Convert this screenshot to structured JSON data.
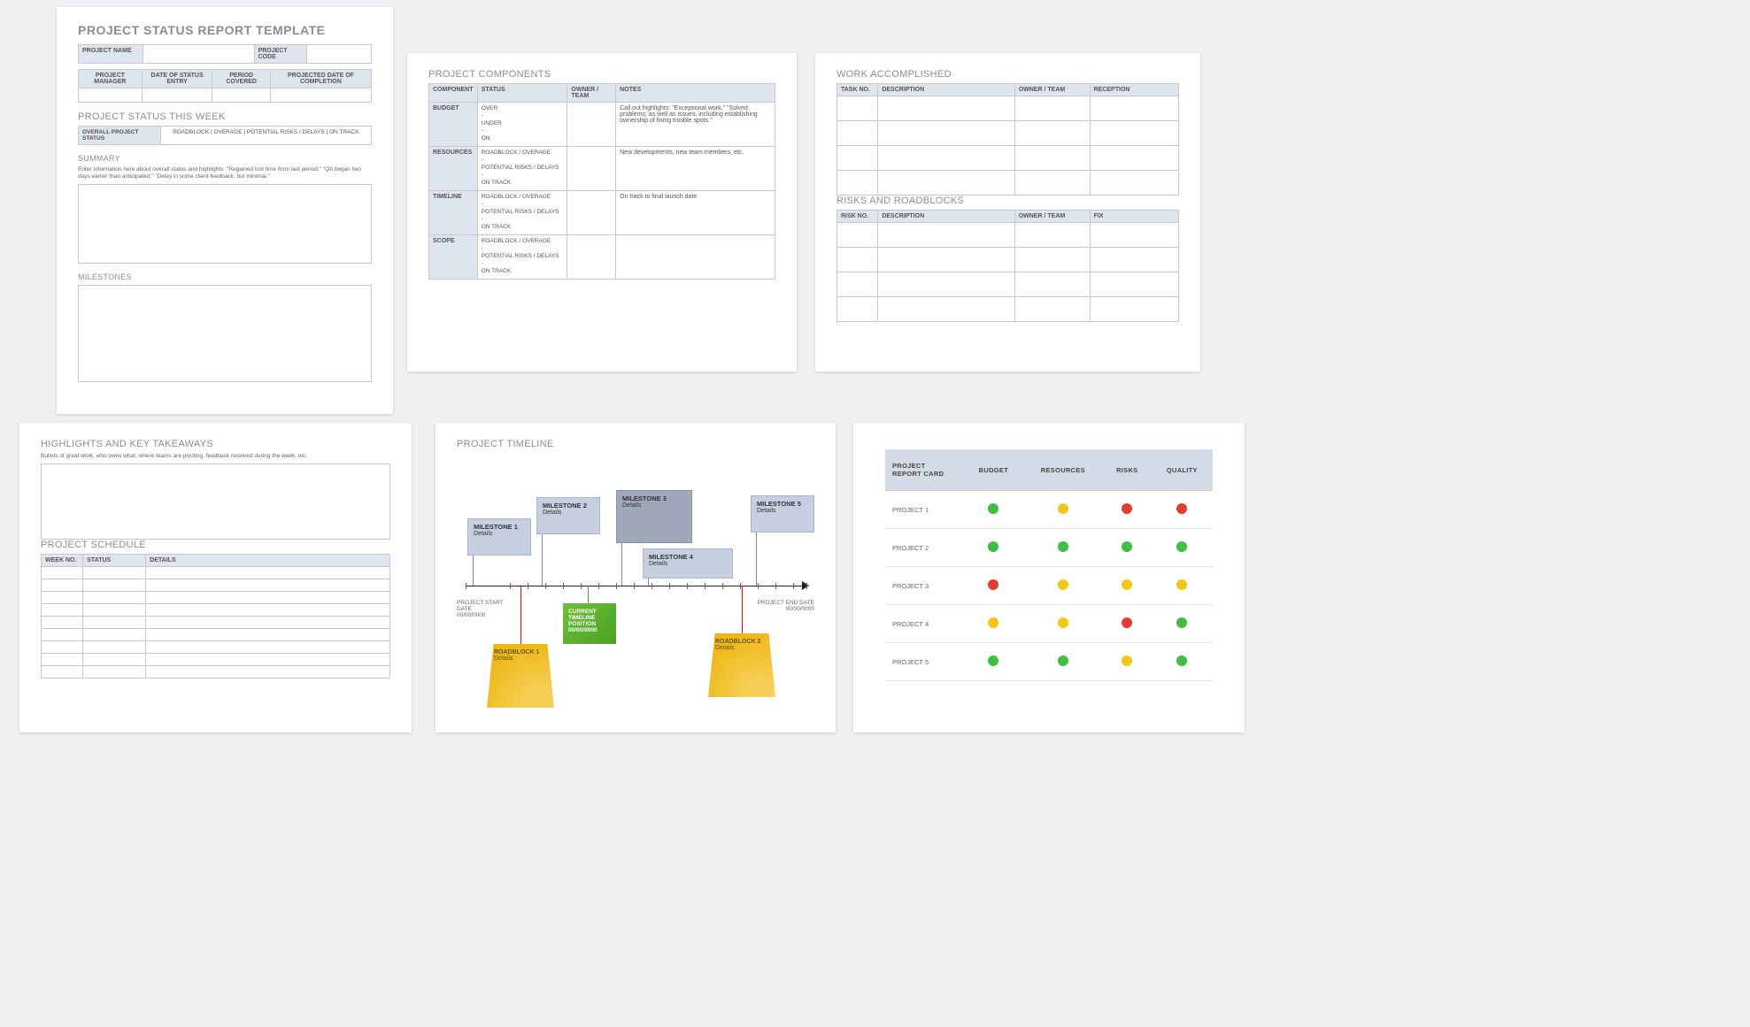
{
  "page1": {
    "title": "PROJECT STATUS REPORT TEMPLATE",
    "nameLabel": "PROJECT NAME",
    "codeLabel": "PROJECT CODE",
    "meta": [
      "PROJECT MANAGER",
      "DATE OF STATUS ENTRY",
      "PERIOD COVERED",
      "PROJECTED DATE OF COMPLETION"
    ],
    "statusWeek": "PROJECT STATUS THIS WEEK",
    "overall": "OVERALL PROJECT STATUS",
    "statuses": "ROADBLOCK / OVERAGE   |   POTENTIAL RISKS / DELAYS   |   ON TRACK",
    "summary": "SUMMARY",
    "summaryNote": "Enter information here about overall status and highlights: \"Regained lost time from last period;\" \"QA began two days earlier than anticipated;\" \"Delay in some client feedback, but minimal.\"",
    "milestones": "MILESTONES"
  },
  "page2": {
    "title": "PROJECT COMPONENTS",
    "headers": [
      "COMPONENT",
      "STATUS",
      "OWNER / TEAM",
      "NOTES"
    ],
    "rows": [
      {
        "c": "BUDGET",
        "s": "OVER\n-\nUNDER\n-\nON",
        "n": "Call out highlights: \"Exceptional work,\" \"Solved problems; as well as issues, including establishing ownership of fixing trouble spots.\""
      },
      {
        "c": "RESOURCES",
        "s": "ROADBLOCK / OVERAGE\n-\nPOTENTIAL RISKS / DELAYS\n-\nON TRACK",
        "n": "New developments, new team members, etc."
      },
      {
        "c": "TIMELINE",
        "s": "ROADBLOCK / OVERAGE\n-\nPOTENTIAL RISKS / DELAYS\n-\nON TRACK",
        "n": "On track to final launch date"
      },
      {
        "c": "SCOPE",
        "s": "ROADBLOCK / OVERAGE\n-\nPOTENTIAL RISKS / DELAYS\n-\nON TRACK",
        "n": ""
      }
    ]
  },
  "page3": {
    "workTitle": "WORK ACCOMPLISHED",
    "workHeaders": [
      "TASK NO.",
      "DESCRIPTION",
      "OWNER / TEAM",
      "RECEPTION"
    ],
    "risksTitle": "RISKS AND ROADBLOCKS",
    "risksHeaders": [
      "RISK NO.",
      "DESCRIPTION",
      "OWNER / TEAM",
      "FIX"
    ]
  },
  "page4": {
    "highlights": "HIGHLIGHTS AND KEY TAKEAWAYS",
    "highlightsNote": "Bullets of great work, who owns what, where teams are pivoting, feedback received during the week, etc.",
    "schedule": "PROJECT SCHEDULE",
    "schedHeaders": [
      "WEEK NO.",
      "STATUS",
      "DETAILS"
    ]
  },
  "page5": {
    "title": "PROJECT TIMELINE",
    "ms1": "MILESTONE 1",
    "ms2": "MILESTONE 2",
    "ms3": "MILESTONE 3",
    "ms4": "MILESTONE 4",
    "ms5": "MILESTONE 5",
    "details": "Details",
    "rb1": "ROADBLOCK 1",
    "rb2": "ROADBLOCK 2",
    "startLabel": "PROJECT START DATE",
    "startDate": "00/00/0000",
    "endLabel": "PROJECT END DATE",
    "endDate": "00/00/0000",
    "currentL1": "CURRENT",
    "currentL2": "TIMELINE",
    "currentL3": "POSITION",
    "currentDate": "00/00/0000"
  },
  "page6": {
    "header": "PROJECT REPORT CARD",
    "cols": [
      "BUDGET",
      "RESOURCES",
      "RISKS",
      "QUALITY"
    ],
    "rows": [
      {
        "name": "PROJECT 1",
        "cells": [
          "g",
          "y",
          "r",
          "r"
        ]
      },
      {
        "name": "PROJECT 2",
        "cells": [
          "g",
          "g",
          "g",
          "g"
        ]
      },
      {
        "name": "PROJECT 3",
        "cells": [
          "r",
          "y",
          "y",
          "y"
        ]
      },
      {
        "name": "PROJECT 4",
        "cells": [
          "y",
          "y",
          "r",
          "g"
        ]
      },
      {
        "name": "PROJECT 5",
        "cells": [
          "g",
          "g",
          "y",
          "g"
        ]
      }
    ]
  }
}
